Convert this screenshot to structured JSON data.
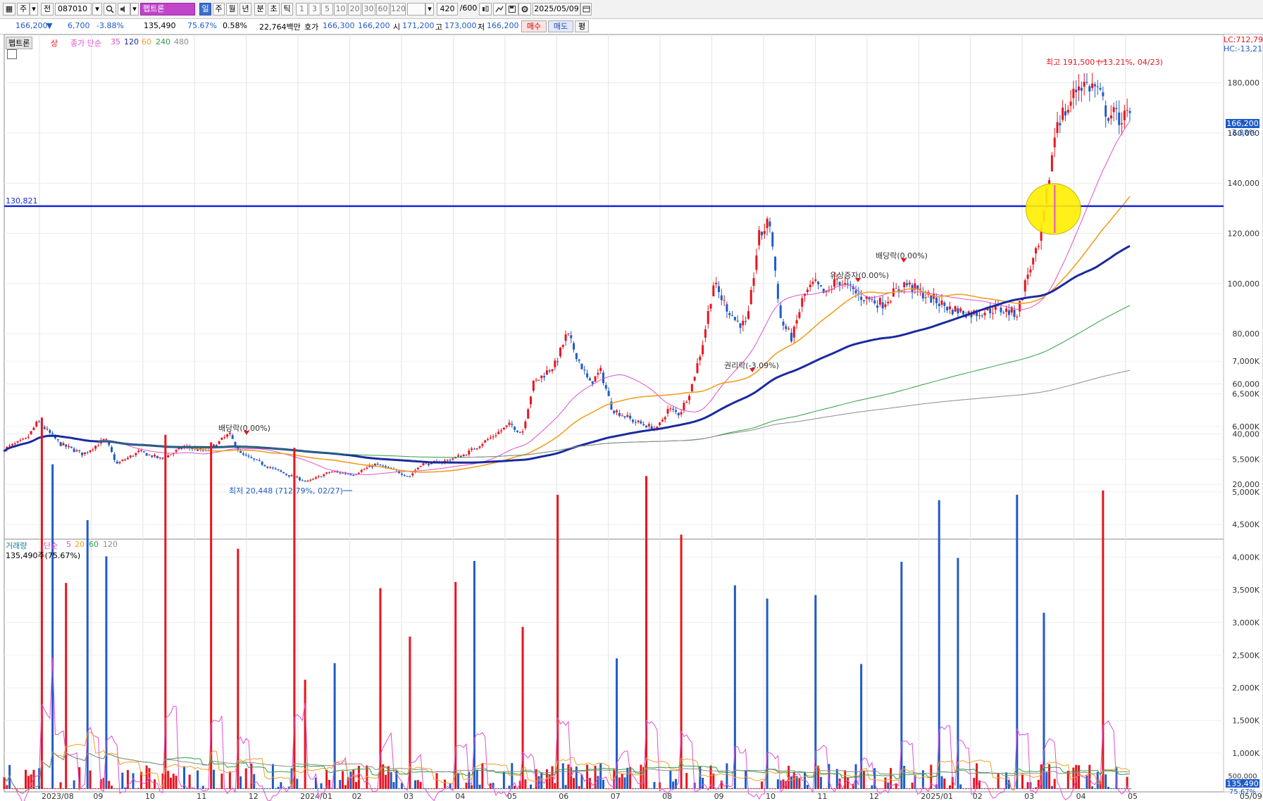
{
  "toolbar": {
    "icon_box": "▦",
    "type_label": "주",
    "dropdown_caret": "▾",
    "code_prefix": "전",
    "code_value": "087010",
    "stock_name": "펩트론",
    "sel_day": "일",
    "week": "주",
    "month": "월",
    "year": "년",
    "minute": "분",
    "second": "초",
    "tick": "틱",
    "periods": [
      "1",
      "3",
      "5",
      "10",
      "20",
      "30",
      "60",
      "120"
    ],
    "count_value": "420",
    "count_total": "/600",
    "date_value": "2025/05/09"
  },
  "info": {
    "price": "166,200",
    "down_arrow": "▼",
    "change": "6,700",
    "change_pct": "-3.88%",
    "volume": "135,490",
    "vol_ratio": "75.67%",
    "turnover": "0.58%",
    "amount": "22,764백만",
    "hoga_label": "호가",
    "hoga_ask": "166,300",
    "hoga_bid": "166,200",
    "open_label": "시",
    "open": "171,200",
    "high_label": "고",
    "high": "173,000",
    "low_label": "저",
    "low": "166,200",
    "buy_button": "매수",
    "sell_button": "매도",
    "eval_button": "평"
  },
  "price_panel": {
    "name_tag": "펩트론",
    "mode": "상",
    "ma_label": "종가 단순",
    "ma_periods": [
      "35",
      "120",
      "60",
      "240",
      "480"
    ],
    "lc_label": "LC:712,79",
    "hc_label": "HC:-13,21",
    "hline_label": "130,821",
    "current_price_tag": "166,200",
    "current_change_tag": "-3.88%",
    "max_annotation": "최고 191,500 (-13.21%, 04/23)",
    "min_annotation": "최저 20,448 (712.79%, 02/27)",
    "events": [
      "배당락(0.00%)",
      "권리락(-3.09%)",
      "유상증자(0.00%)",
      "배당락(0.00%)"
    ]
  },
  "volume_panel": {
    "label": "거래량",
    "ma_label": "단순",
    "ma_periods": [
      "5",
      "20",
      "60",
      "120"
    ],
    "current_volume": "135,490주(75.67%)",
    "current_tag": "135,490",
    "current_pct_tag": "75.67%",
    "upper_tag": "500,000"
  },
  "colors": {
    "up": "#e8141e",
    "down": "#1f5bc6",
    "hline": "#1426d9",
    "ma35": "#e050d0",
    "ma60": "#f0a020",
    "ma120": "#1a2aa0",
    "ma240": "#2ca040",
    "ma480": "#8c8c8c",
    "highlight": "#ffee00"
  },
  "chart_data": {
    "type": "candlestick",
    "price_ylim": [
      0,
      200000
    ],
    "price_ticks": [
      "20,000",
      "40,000",
      "60,000",
      "80,000",
      "100,000",
      "120,000",
      "140,000",
      "160,000",
      "180,000"
    ],
    "volume_ticks": [
      "1,000K",
      "1,500K",
      "2,000K",
      "2,500K",
      "3,000K",
      "3,500K",
      "4,000K",
      "4,500K",
      "5,000K",
      "5,500K",
      "6,000K",
      "6,500K",
      "7,000K"
    ],
    "x_labels": [
      "2023/08",
      "09",
      "10",
      "11",
      "12",
      "2024/01",
      "02",
      "03",
      "04",
      "05",
      "06",
      "07",
      "08",
      "09",
      "10",
      "11",
      "12",
      "2025/01",
      "02",
      "03",
      "04",
      "05"
    ],
    "x_end_label": "05/09",
    "horizontal_line": 130821,
    "max_point": {
      "value": 191500,
      "date": "04/23"
    },
    "min_point": {
      "value": 20448,
      "date": "02/27"
    },
    "price_path": [
      [
        0,
        34000
      ],
      [
        0.02,
        38000
      ],
      [
        0.03,
        45000
      ],
      [
        0.05,
        36000
      ],
      [
        0.07,
        32000
      ],
      [
        0.09,
        38000
      ],
      [
        0.1,
        28000
      ],
      [
        0.12,
        33000
      ],
      [
        0.14,
        30000
      ],
      [
        0.16,
        35000
      ],
      [
        0.18,
        33000
      ],
      [
        0.2,
        40000
      ],
      [
        0.21,
        32000
      ],
      [
        0.23,
        28000
      ],
      [
        0.25,
        24000
      ],
      [
        0.27,
        21000
      ],
      [
        0.29,
        25000
      ],
      [
        0.31,
        24000
      ],
      [
        0.33,
        28000
      ],
      [
        0.35,
        25000
      ],
      [
        0.36,
        23000
      ],
      [
        0.37,
        28000
      ],
      [
        0.39,
        29000
      ],
      [
        0.41,
        32000
      ],
      [
        0.43,
        38000
      ],
      [
        0.45,
        44000
      ],
      [
        0.46,
        40000
      ],
      [
        0.47,
        60000
      ],
      [
        0.49,
        68000
      ],
      [
        0.5,
        80000
      ],
      [
        0.52,
        60000
      ],
      [
        0.53,
        65000
      ],
      [
        0.54,
        50000
      ],
      [
        0.56,
        45000
      ],
      [
        0.58,
        42000
      ],
      [
        0.59,
        50000
      ],
      [
        0.6,
        48000
      ],
      [
        0.61,
        58000
      ],
      [
        0.62,
        75000
      ],
      [
        0.63,
        100000
      ],
      [
        0.64,
        92000
      ],
      [
        0.65,
        85000
      ],
      [
        0.66,
        83000
      ],
      [
        0.67,
        118000
      ],
      [
        0.68,
        125000
      ],
      [
        0.69,
        85000
      ],
      [
        0.7,
        78000
      ],
      [
        0.71,
        95000
      ],
      [
        0.72,
        100000
      ],
      [
        0.73,
        95000
      ],
      [
        0.74,
        102000
      ],
      [
        0.75,
        98000
      ],
      [
        0.76,
        95000
      ],
      [
        0.78,
        92000
      ],
      [
        0.8,
        100000
      ],
      [
        0.82,
        95000
      ],
      [
        0.84,
        90000
      ],
      [
        0.86,
        88000
      ],
      [
        0.88,
        90000
      ],
      [
        0.9,
        88000
      ],
      [
        0.91,
        105000
      ],
      [
        0.92,
        115000
      ],
      [
        0.935,
        165000
      ],
      [
        0.945,
        170000
      ],
      [
        0.955,
        180000
      ],
      [
        0.97,
        178000
      ],
      [
        0.98,
        168000
      ],
      [
        0.99,
        166200
      ]
    ]
  }
}
